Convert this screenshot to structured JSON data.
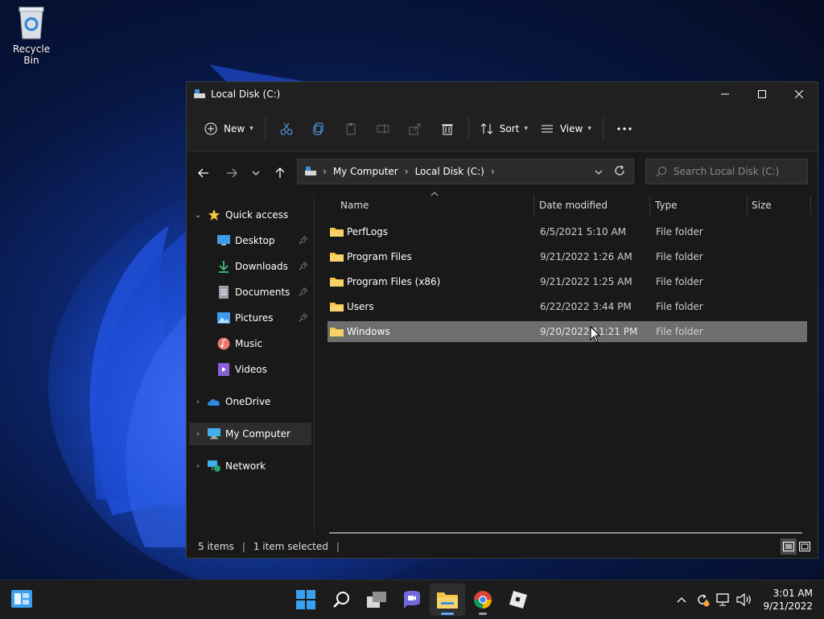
{
  "desktop": {
    "recycle_bin_label": "Recycle Bin"
  },
  "window": {
    "title": "Local Disk (C:)",
    "controls": [
      "minimize",
      "maximize",
      "close"
    ]
  },
  "commandbar": {
    "new_label": "New",
    "sort_label": "Sort",
    "view_label": "View",
    "icons": [
      "cut-icon",
      "copy-icon",
      "paste-icon",
      "rename-icon",
      "share-icon",
      "delete-icon",
      "more-icon"
    ]
  },
  "address": {
    "crumbs": [
      "My Computer",
      "Local Disk (C:)"
    ]
  },
  "search": {
    "placeholder": "Search Local Disk (C:)"
  },
  "sidebar": {
    "items": [
      {
        "label": "Quick access",
        "icon": "star-icon"
      },
      {
        "label": "Desktop",
        "icon": "desktop-icon",
        "pinned": true
      },
      {
        "label": "Downloads",
        "icon": "downloads-icon",
        "pinned": true
      },
      {
        "label": "Documents",
        "icon": "documents-icon",
        "pinned": true
      },
      {
        "label": "Pictures",
        "icon": "pictures-icon",
        "pinned": true
      },
      {
        "label": "Music",
        "icon": "music-icon"
      },
      {
        "label": "Videos",
        "icon": "videos-icon"
      },
      {
        "label": "OneDrive",
        "icon": "onedrive-icon"
      },
      {
        "label": "My Computer",
        "icon": "computer-icon",
        "selected": true
      },
      {
        "label": "Network",
        "icon": "network-icon"
      }
    ]
  },
  "list": {
    "columns": [
      "Name",
      "Date modified",
      "Type",
      "Size"
    ],
    "rows": [
      {
        "name": "PerfLogs",
        "date": "6/5/2021 5:10 AM",
        "type": "File folder"
      },
      {
        "name": "Program Files",
        "date": "9/21/2022 1:26 AM",
        "type": "File folder"
      },
      {
        "name": "Program Files (x86)",
        "date": "9/21/2022 1:25 AM",
        "type": "File folder"
      },
      {
        "name": "Users",
        "date": "6/22/2022 3:44 PM",
        "type": "File folder"
      },
      {
        "name": "Windows",
        "date": "9/20/2022 11:21 PM",
        "type": "File folder",
        "selected": true
      }
    ]
  },
  "status": {
    "items": "5 items",
    "selected": "1 item selected"
  },
  "taskbar": {
    "apps": [
      "start-icon",
      "search-icon",
      "task-view-icon",
      "chat-icon",
      "file-explorer-icon",
      "chrome-icon",
      "roblox-icon"
    ],
    "clock_time": "3:01 AM",
    "clock_date": "9/21/2022"
  },
  "colors": {
    "accent": "#62a6ff",
    "folder": "#f6c342",
    "selection": "#6e6e6e"
  }
}
